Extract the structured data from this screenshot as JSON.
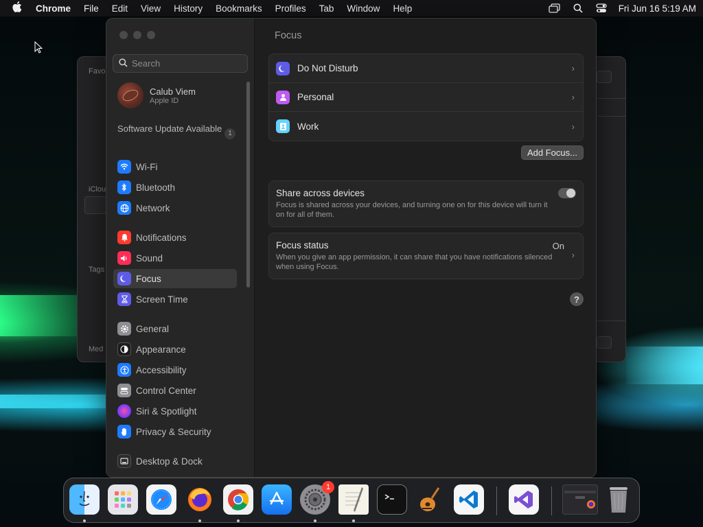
{
  "menubar": {
    "apple_icon": "apple-icon",
    "app_name": "Chrome",
    "items": [
      "File",
      "Edit",
      "View",
      "History",
      "Bookmarks",
      "Profiles",
      "Tab",
      "Window",
      "Help"
    ],
    "status_icons": [
      "screen-mirroring-icon",
      "search-icon",
      "control-center-icon"
    ],
    "clock": "Fri Jun 16  5:19 AM"
  },
  "background_window": {
    "labels": [
      "Favo",
      "iClou",
      "Tags",
      "Med"
    ]
  },
  "settings": {
    "search": {
      "placeholder": "Search",
      "value": ""
    },
    "profile": {
      "name": "Calub Viem",
      "subtitle": "Apple ID"
    },
    "update": {
      "label": "Software Update Available",
      "count": "1"
    },
    "sidebar": {
      "items": [
        {
          "label": "Wi-Fi",
          "icon": "wifi-icon",
          "color": "#1e7bff"
        },
        {
          "label": "Bluetooth",
          "icon": "bluetooth-icon",
          "color": "#1e7bff"
        },
        {
          "label": "Network",
          "icon": "globe-icon",
          "color": "#1e7bff"
        },
        {
          "label": "Notifications",
          "icon": "bell-icon",
          "color": "#ff3b30"
        },
        {
          "label": "Sound",
          "icon": "speaker-icon",
          "color": "#ff2d55"
        },
        {
          "label": "Focus",
          "icon": "moon-icon",
          "color": "#5e5ce6",
          "active": true
        },
        {
          "label": "Screen Time",
          "icon": "hourglass-icon",
          "color": "#5e5ce6"
        },
        {
          "label": "General",
          "icon": "gear-icon",
          "color": "#8e8e93"
        },
        {
          "label": "Appearance",
          "icon": "appearance-icon",
          "color": "#1c1c1e"
        },
        {
          "label": "Accessibility",
          "icon": "accessibility-icon",
          "color": "#1e7bff"
        },
        {
          "label": "Control Center",
          "icon": "control-center-icon",
          "color": "#8e8e93"
        },
        {
          "label": "Siri & Spotlight",
          "icon": "siri-icon",
          "color": "#b14bd6"
        },
        {
          "label": "Privacy & Security",
          "icon": "hand-icon",
          "color": "#1e7bff"
        },
        {
          "label": "Desktop & Dock",
          "icon": "desktop-icon",
          "color": "#2c2c2e"
        }
      ]
    },
    "main": {
      "title": "Focus",
      "focus_modes": [
        {
          "label": "Do Not Disturb",
          "icon": "moon-icon",
          "color": "#5e5ce6"
        },
        {
          "label": "Personal",
          "icon": "person-icon",
          "color": "#bf5af2"
        },
        {
          "label": "Work",
          "icon": "badge-icon",
          "color": "#64d2ff"
        }
      ],
      "add_focus": "Add Focus...",
      "share": {
        "title": "Share across devices",
        "description": "Focus is shared across your devices, and turning one on for this device will turn it on for all of them.",
        "enabled": true
      },
      "status": {
        "title": "Focus status",
        "value": "On",
        "description": "When you give an app permission, it can share that you have notifications silenced when using Focus."
      },
      "help": "?"
    }
  },
  "dock": {
    "apps": [
      {
        "name": "finder-icon",
        "running": true
      },
      {
        "name": "launchpad-icon",
        "running": false
      },
      {
        "name": "safari-icon",
        "running": false
      },
      {
        "name": "firefox-icon",
        "running": true
      },
      {
        "name": "chrome-icon",
        "running": true
      },
      {
        "name": "app-store-icon",
        "running": false
      },
      {
        "name": "system-settings-icon",
        "running": true,
        "badge": "1"
      },
      {
        "name": "textedit-icon",
        "running": true
      },
      {
        "name": "terminal-icon",
        "running": false
      },
      {
        "name": "garageband-icon",
        "running": false
      },
      {
        "name": "vscode-icon",
        "running": false
      },
      {
        "name": "visual-studio-icon",
        "running": false
      },
      {
        "name": "firefox-window-thumbnail",
        "running": false
      },
      {
        "name": "trash-icon",
        "running": false
      }
    ]
  }
}
